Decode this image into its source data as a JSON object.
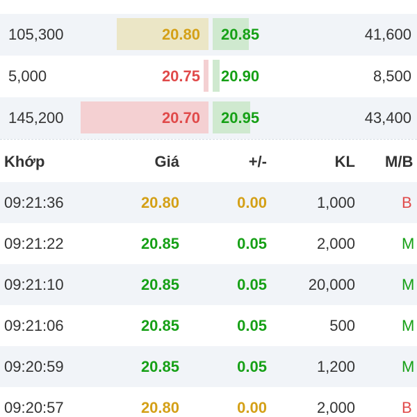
{
  "order_book": {
    "rows": [
      {
        "bid_volume": "105,300",
        "bid_price": "20.80",
        "bid_color": "#d4a017",
        "bid_bar_fraction": 0.61,
        "ask_price": "20.85",
        "ask_color": "#16a016",
        "ask_bar_fraction": 0.22,
        "ask_volume": "41,600"
      },
      {
        "bid_volume": "5,000",
        "bid_price": "20.75",
        "bid_color": "#e04a4a",
        "bid_bar_fraction": 0.03,
        "ask_price": "20.90",
        "ask_color": "#16a016",
        "ask_bar_fraction": 0.04,
        "ask_volume": "8,500"
      },
      {
        "bid_volume": "145,200",
        "bid_price": "20.70",
        "bid_color": "#e04a4a",
        "bid_bar_fraction": 0.86,
        "ask_price": "20.95",
        "ask_color": "#16a016",
        "ask_bar_fraction": 0.23,
        "ask_volume": "43,400"
      }
    ]
  },
  "trades": {
    "headers": {
      "time": "Khớp",
      "price": "Giá",
      "change": "+/-",
      "volume": "KL",
      "side": "M/B"
    },
    "rows": [
      {
        "time": "09:21:36",
        "price": "20.80",
        "change": "0.00",
        "volume": "1,000",
        "side": "B",
        "tone": "yellow"
      },
      {
        "time": "09:21:22",
        "price": "20.85",
        "change": "0.05",
        "volume": "2,000",
        "side": "M",
        "tone": "green"
      },
      {
        "time": "09:21:10",
        "price": "20.85",
        "change": "0.05",
        "volume": "20,000",
        "side": "M",
        "tone": "green"
      },
      {
        "time": "09:21:06",
        "price": "20.85",
        "change": "0.05",
        "volume": "500",
        "side": "M",
        "tone": "green"
      },
      {
        "time": "09:20:59",
        "price": "20.85",
        "change": "0.05",
        "volume": "1,200",
        "side": "M",
        "tone": "green"
      },
      {
        "time": "09:20:57",
        "price": "20.80",
        "change": "0.00",
        "volume": "2,000",
        "side": "B",
        "tone": "yellow"
      }
    ]
  },
  "colors": {
    "yellow": "#d4a017",
    "green": "#16a016",
    "red": "#e04a4a",
    "buy_side": "#16a016",
    "sell_side": "#e04a4a",
    "row_alt_bg": "#f1f4f8"
  }
}
